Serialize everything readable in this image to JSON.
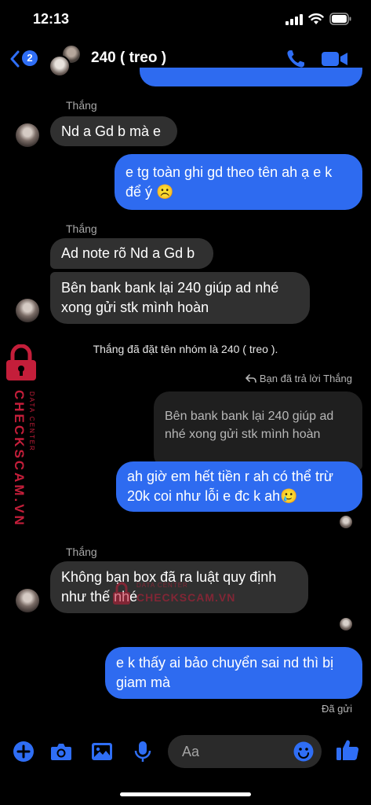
{
  "status_bar": {
    "time": "12:13"
  },
  "header": {
    "back_badge": "2",
    "title": "240 ( treo )"
  },
  "messages": {
    "group1_sender": "Thắng",
    "msg1": "Nd a Gd b mà e",
    "msg2": "e tg toàn ghi gd theo tên ah ạ e k để ý ☹️",
    "group2_sender": "Thắng",
    "msg3": "Ad note rõ Nd a Gd b",
    "msg4": "Bên bank bank lại 240 giúp ad nhé xong gửi stk mình hoàn",
    "system_rename": "Thắng đã đặt tên nhóm là 240 ( treo ).",
    "reply_note": "Bạn đã trả lời Thắng",
    "quoted": "Bên bank bank lại 240 giúp ad nhé xong gửi stk mình hoàn",
    "msg5": "ah giờ em hết tiền r ah có thể trừ 20k coi như lỗi e đc k ah🥲",
    "group3_sender": "Thắng",
    "msg6": "Không bạn box đã ra luật quy định như thế nhé",
    "msg7": "e k thấy ai bảo chuyển sai nd thì bị giam mà",
    "sent_status": "Đã gửi"
  },
  "watermark": {
    "main": "CHECKSCAM.VN",
    "sub": "DATA CENTER"
  },
  "composer": {
    "placeholder": "Aa"
  },
  "colors": {
    "accent": "#2e6bf0",
    "incoming_bubble": "#303030",
    "watermark": "#c41e3a"
  }
}
